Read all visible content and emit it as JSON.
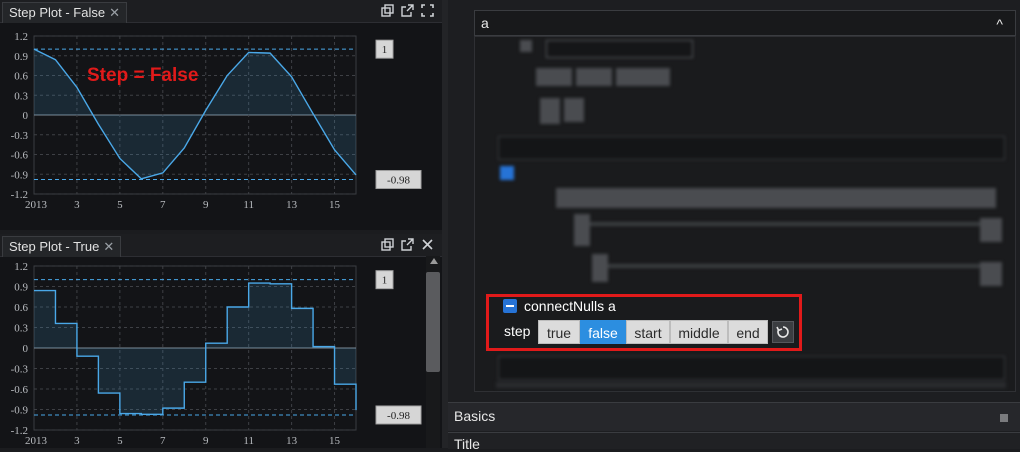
{
  "panels": [
    {
      "tab_label": "Step Plot - False",
      "close_glyph": "✕",
      "annotation": "Step = False",
      "value_labels": [
        "1",
        "-0.98"
      ]
    },
    {
      "tab_label": "Step Plot - True",
      "close_glyph": "✕",
      "value_labels": [
        "1",
        "-0.98"
      ]
    }
  ],
  "icons": [
    "popout-icon",
    "external-link-icon",
    "fullscreen-icon",
    "close-icon",
    "reset-icon"
  ],
  "chart_data": [
    {
      "type": "line",
      "step": false,
      "x": [
        2013,
        2014,
        2015,
        2016,
        2017,
        2018,
        2019,
        2020,
        2021,
        2022,
        2023,
        2024,
        2025,
        2026,
        2027,
        2028
      ],
      "values": [
        1.0,
        0.84,
        0.42,
        -0.14,
        -0.66,
        -0.97,
        -0.88,
        -0.5,
        0.07,
        0.6,
        0.95,
        0.94,
        0.58,
        0.02,
        -0.53,
        -0.91
      ],
      "xticks": [
        "2013",
        "3",
        "5",
        "7",
        "9",
        "11",
        "13",
        "15"
      ],
      "yticks": [
        "1.2",
        "0.9",
        "0.6",
        "0.3",
        "0",
        "-0.3",
        "-0.6",
        "-0.9",
        "-1.2"
      ],
      "ylim": [
        -1.2,
        1.2
      ],
      "reference_lines": [
        1.0,
        -0.98
      ],
      "grid": true,
      "color": "#4aa8e8"
    },
    {
      "type": "line",
      "step": true,
      "x": [
        2013,
        2014,
        2015,
        2016,
        2017,
        2018,
        2019,
        2020,
        2021,
        2022,
        2023,
        2024,
        2025,
        2026,
        2027,
        2028
      ],
      "values": [
        0.84,
        0.36,
        -0.12,
        -0.66,
        -0.96,
        -0.97,
        -0.88,
        -0.5,
        0.07,
        0.6,
        0.95,
        0.94,
        0.58,
        0.02,
        -0.53,
        -0.91
      ],
      "xticks": [
        "2013",
        "3",
        "5",
        "7",
        "9",
        "11",
        "13",
        "15"
      ],
      "yticks": [
        "1.2",
        "0.9",
        "0.6",
        "0.3",
        "0",
        "-0.3",
        "-0.6",
        "-0.9",
        "-1.2"
      ],
      "ylim": [
        -1.2,
        1.2
      ],
      "reference_lines": [
        1.0,
        -0.98
      ],
      "grid": true,
      "color": "#4aa8e8"
    }
  ],
  "inspector": {
    "accordion_label": "a",
    "accordion_caret": "^",
    "connect_nulls_label": "connectNulls a",
    "step_label": "step",
    "step_options": [
      "true",
      "false",
      "start",
      "middle",
      "end"
    ],
    "step_selected": "false",
    "sections": [
      "Basics",
      "Title"
    ]
  },
  "colors": {
    "accent": "#2c8ee0",
    "highlight": "#e11a1a",
    "annotation": "#e11a1a"
  }
}
